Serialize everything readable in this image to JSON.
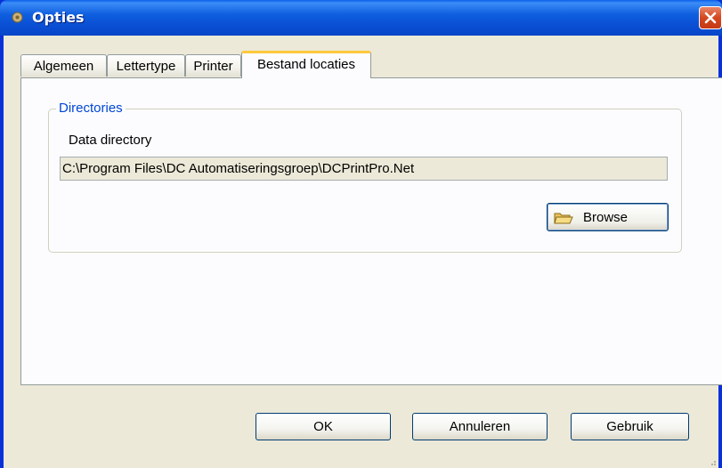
{
  "window": {
    "title": "Opties"
  },
  "tabs": [
    {
      "label": "Algemeen",
      "active": false
    },
    {
      "label": "Lettertype",
      "active": false
    },
    {
      "label": "Printer",
      "active": false
    },
    {
      "label": "Bestand locaties",
      "active": true
    }
  ],
  "directories": {
    "group_title": "Directories",
    "data_label": "Data directory",
    "data_path": "C:\\Program Files\\DC Automatiseringsgroep\\DCPrintPro.Net",
    "browse_label": "Browse"
  },
  "footer": {
    "ok_label": "OK",
    "cancel_label": "Annuleren",
    "apply_label": "Gebruik"
  },
  "colors": {
    "titlebar": "#0a4fd5",
    "client": "#ece9d8",
    "group_title": "#0046d5",
    "active_tab_accent": "#ffc83c"
  },
  "icons": {
    "title": "gear-icon",
    "close": "close-icon",
    "browse": "folder-icon"
  }
}
